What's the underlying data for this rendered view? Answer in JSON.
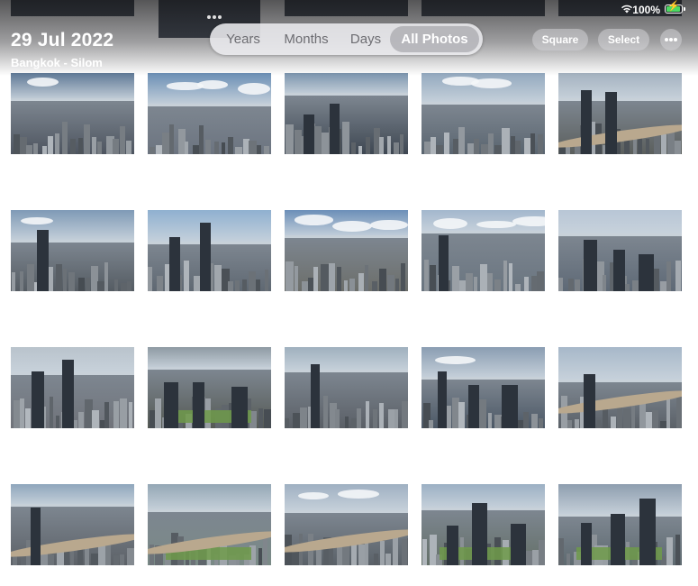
{
  "header": {
    "date": "29 Jul 2022",
    "location": "Bangkok - Silom"
  },
  "view_switcher": {
    "items": [
      {
        "label": "Years",
        "active": false
      },
      {
        "label": "Months",
        "active": false
      },
      {
        "label": "Days",
        "active": false
      },
      {
        "label": "All Photos",
        "active": true
      }
    ]
  },
  "toolbar": {
    "square_label": "Square",
    "select_label": "Select",
    "more_icon": "ellipsis-icon"
  },
  "status_bar": {
    "battery_percent": "100%",
    "wifi_icon": "wifi-icon",
    "battery_icon": "battery-charging-icon",
    "battery_level": 1.0,
    "battery_color": "#4cd964"
  },
  "photos": [
    {
      "sky": "#5f7996",
      "ground": "#4e5560",
      "river": false,
      "clouds": 1,
      "tall": 0
    },
    {
      "sky": "#6b8fb5",
      "ground": "#6c7480",
      "river": false,
      "clouds": 3,
      "tall": 0
    },
    {
      "sky": "#7b94ad",
      "ground": "#3e4752",
      "river": false,
      "clouds": 0,
      "tall": 2
    },
    {
      "sky": "#93a9bf",
      "ground": "#5a6570",
      "river": false,
      "clouds": 2,
      "tall": 0
    },
    {
      "sky": "#a4b2c0",
      "ground": "#5b5f5d",
      "river": true,
      "clouds": 0,
      "tall": 2
    },
    {
      "sky": "#7f9ab6",
      "ground": "#555c63",
      "river": false,
      "clouds": 1,
      "tall": 1
    },
    {
      "sky": "#8fb0d0",
      "ground": "#5f6872",
      "river": false,
      "clouds": 0,
      "tall": 2
    },
    {
      "sky": "#6c8fb8",
      "ground": "#6c6e6a",
      "river": false,
      "clouds": 3,
      "tall": 0
    },
    {
      "sky": "#a3b7cd",
      "ground": "#6a7580",
      "river": false,
      "clouds": 3,
      "tall": 1
    },
    {
      "sky": "#b8c6d6",
      "ground": "#5e6976",
      "river": false,
      "clouds": 0,
      "tall": 3
    },
    {
      "sky": "#b9c3cc",
      "ground": "#70737a",
      "river": false,
      "clouds": 0,
      "tall": 2
    },
    {
      "sky": "#8e9aa3",
      "ground": "#555a55",
      "river": false,
      "clouds": 0,
      "tall": 3,
      "park": true
    },
    {
      "sky": "#9fb0be",
      "ground": "#5a5f66",
      "river": false,
      "clouds": 0,
      "tall": 1
    },
    {
      "sky": "#8a9db2",
      "ground": "#4c5866",
      "river": false,
      "clouds": 1,
      "tall": 3
    },
    {
      "sky": "#a7b8c9",
      "ground": "#5b6168",
      "river": true,
      "clouds": 0,
      "tall": 1
    },
    {
      "sky": "#8fa6bc",
      "ground": "#5c6167",
      "river": true,
      "clouds": 0,
      "tall": 1
    },
    {
      "sky": "#94a7b5",
      "ground": "#7a8a86",
      "river": true,
      "clouds": 0,
      "tall": 0,
      "park": true
    },
    {
      "sky": "#9fb0c2",
      "ground": "#5a6168",
      "river": true,
      "clouds": 2,
      "tall": 0
    },
    {
      "sky": "#9cb0c4",
      "ground": "#647068",
      "river": false,
      "clouds": 0,
      "tall": 3,
      "park": true
    },
    {
      "sky": "#8e9eaf",
      "ground": "#5e6a70",
      "river": false,
      "clouds": 0,
      "tall": 3,
      "park": true
    }
  ]
}
